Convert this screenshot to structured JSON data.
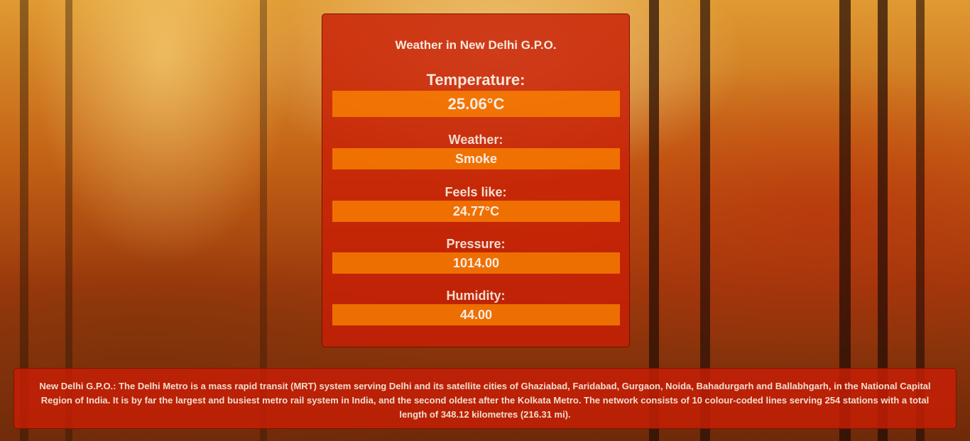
{
  "card": {
    "title": "Weather in New Delhi G.P.O.",
    "temperature": {
      "label": "Temperature:",
      "value": "25.06°C"
    },
    "weather": {
      "label": "Weather:",
      "value": "Smoke"
    },
    "feels_like": {
      "label": "Feels like:",
      "value": "24.77°C"
    },
    "pressure": {
      "label": "Pressure:",
      "value": "1014.00"
    },
    "humidity": {
      "label": "Humidity:",
      "value": "44.00"
    }
  },
  "info": {
    "text": "New Delhi G.P.O.: The Delhi Metro is a mass rapid transit (MRT) system serving Delhi and its satellite cities of Ghaziabad, Faridabad, Gurgaon, Noida, Bahadurgarh and Ballabhgarh, in the National Capital Region of India. It is by far the largest and busiest metro rail system in India, and the second oldest after the Kolkata Metro. The network consists of 10 colour-coded lines serving 254 stations with a total length of 348.12 kilometres (216.31 mi)."
  },
  "colors": {
    "panel": "#c81e05",
    "value_box": "#ff8c00",
    "text": "#f7e8dc"
  }
}
